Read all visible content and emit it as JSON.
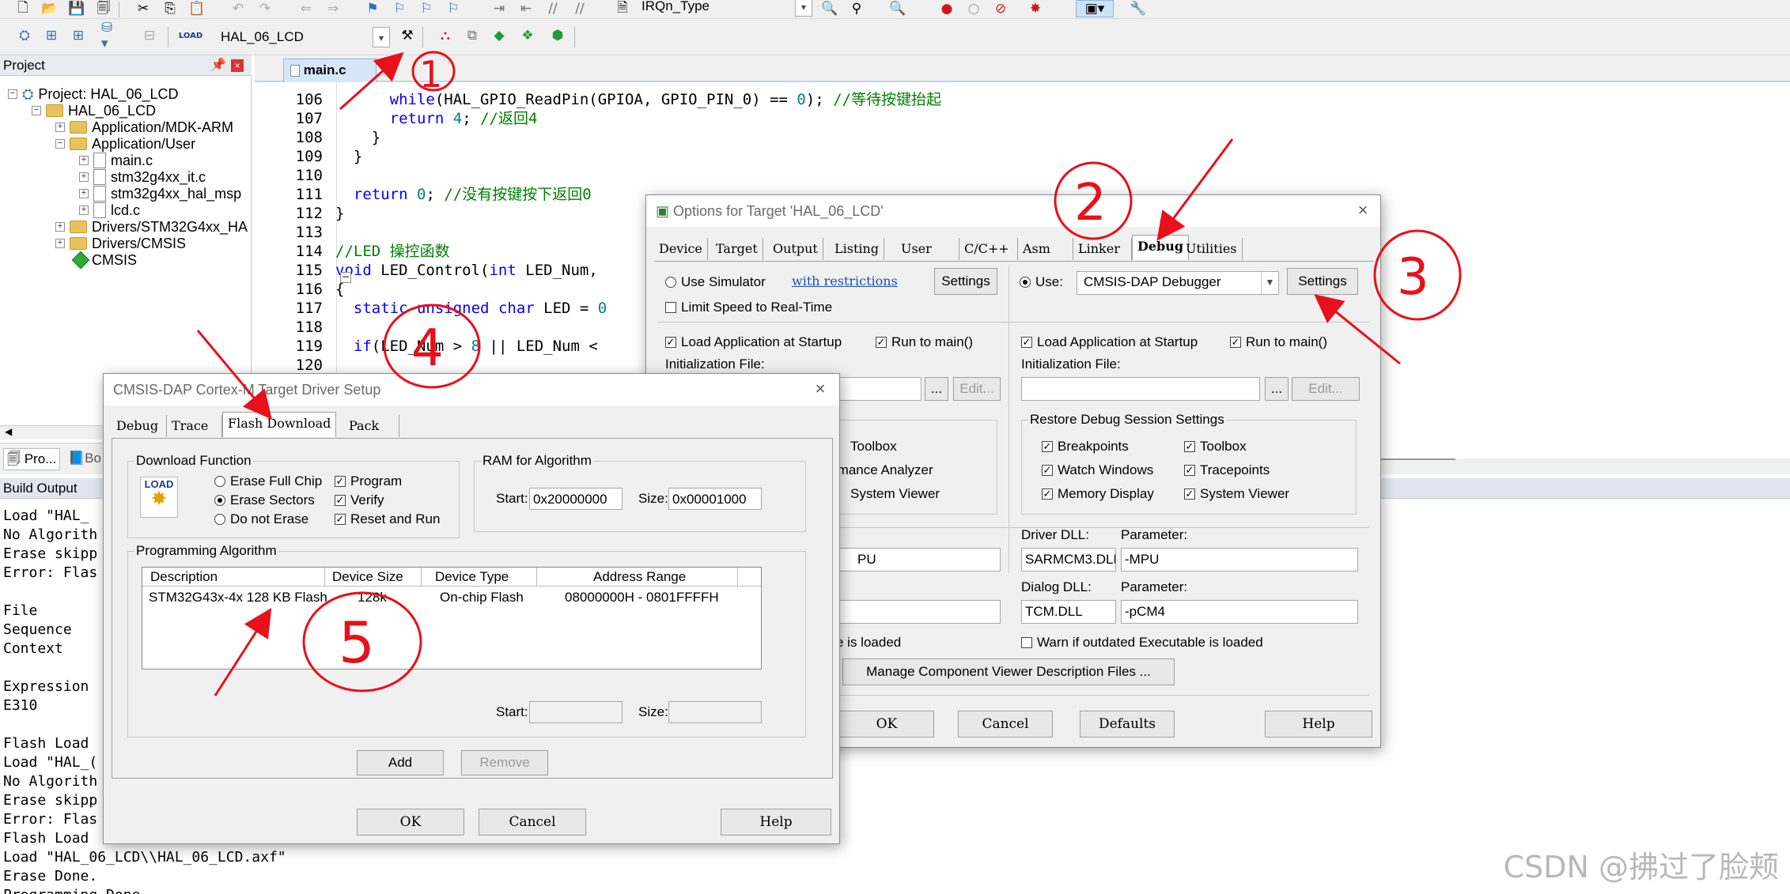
{
  "toolbar1": {
    "target_combo": "IRQn_Type"
  },
  "toolbar2": {
    "project_combo": "HAL_06_LCD"
  },
  "project_pane": {
    "title": "Project",
    "tree": [
      {
        "label": "Project: HAL_06_LCD",
        "kind": "root"
      },
      {
        "label": "HAL_06_LCD",
        "kind": "target"
      },
      {
        "label": "Application/MDK-ARM",
        "kind": "folder"
      },
      {
        "label": "Application/User",
        "kind": "folder"
      },
      {
        "label": "main.c",
        "kind": "file"
      },
      {
        "label": "stm32g4xx_it.c",
        "kind": "file"
      },
      {
        "label": "stm32g4xx_hal_msp",
        "kind": "file"
      },
      {
        "label": "lcd.c",
        "kind": "file"
      },
      {
        "label": "Drivers/STM32G4xx_HA",
        "kind": "folder"
      },
      {
        "label": "Drivers/CMSIS",
        "kind": "folder"
      },
      {
        "label": "CMSIS",
        "kind": "component"
      }
    ],
    "bottom_tabs": [
      "Pro...",
      "Bo"
    ]
  },
  "editor": {
    "tab": "main.c",
    "lines": [
      {
        "n": "106",
        "code": "      while(HAL_GPIO_ReadPin(GPIOA, GPIO_PIN_0) == 0); //等待按键抬起"
      },
      {
        "n": "107",
        "code": "      return 4; //返回4"
      },
      {
        "n": "108",
        "code": "    }"
      },
      {
        "n": "109",
        "code": "  }"
      },
      {
        "n": "110",
        "code": ""
      },
      {
        "n": "111",
        "code": "  return 0; //没有按键按下返回0"
      },
      {
        "n": "112",
        "code": "}"
      },
      {
        "n": "113",
        "code": ""
      },
      {
        "n": "114",
        "code": "//LED 操控函数"
      },
      {
        "n": "115",
        "code": "void LED_Control(int LED_Num,"
      },
      {
        "n": "116",
        "code": "{"
      },
      {
        "n": "117",
        "code": "  static unsigned char LED = 0"
      },
      {
        "n": "118",
        "code": ""
      },
      {
        "n": "119",
        "code": "  if(LED_Num > 8 || LED_Num <"
      },
      {
        "n": "120",
        "code": ""
      }
    ]
  },
  "build_output": {
    "title": "Build Output",
    "lines": [
      "Load \"HAL_",
      "No Algorith",
      "Erase skipp",
      "Error: Flas",
      "",
      "File",
      "Sequence",
      "Context",
      "",
      "Expression",
      "E310",
      "",
      "Flash Load",
      "Load \"HAL_(",
      "No Algorith",
      "Erase skipp",
      "Error: Flas",
      "Flash Load",
      "Load \"HAL_06_LCD\\\\HAL_06_LCD.axf\"",
      "Erase Done.",
      "Programming Done."
    ]
  },
  "options_dialog": {
    "title": "Options for Target 'HAL_06_LCD'",
    "tabs": [
      "Device",
      "Target",
      "Output",
      "Listing",
      "User",
      "C/C++",
      "Asm",
      "Linker",
      "Debug",
      "Utilities"
    ],
    "active_tab": "Debug",
    "use_simulator": "Use Simulator",
    "with_restrictions": "with restrictions",
    "settings": "Settings",
    "use": "Use:",
    "debugger": "CMSIS-DAP Debugger",
    "limit_speed": "Limit Speed to Real-Time",
    "load_app": "Load Application at Startup",
    "run_to_main": "Run to main()",
    "init_file": "Initialization File:",
    "edit": "Edit...",
    "browse": "...",
    "restore_group": "Restore Debug Session Settings",
    "breakpoints": "Breakpoints",
    "toolbox": "Toolbox",
    "watch_windows": "Watch Windows",
    "tracepoints": "Tracepoints",
    "memory_display": "Memory Display",
    "system_viewer": "System Viewer",
    "left_restore_partial": "ngs",
    "left_toolbox": "Toolbox",
    "left_perf": "rmance Analyzer",
    "left_sysviewer": "System Viewer",
    "driver_dll": "Driver DLL:",
    "parameter": "Parameter:",
    "dialog_dll": "Dialog DLL:",
    "driver_dll_value": "SARMCM3.DLL",
    "driver_param": "-MPU",
    "dialog_dll_value": "TCM.DLL",
    "dialog_param": "-pCM4",
    "left_driver_partial": "PU",
    "warn_outdated": "Warn if outdated Executable is loaded",
    "left_warn_partial": "e is loaded",
    "manage_viewer": "Manage Component Viewer Description Files ...",
    "ok": "OK",
    "cancel": "Cancel",
    "defaults": "Defaults",
    "help": "Help"
  },
  "cmsis_dialog": {
    "title": "CMSIS-DAP Cortex-M Target Driver Setup",
    "tabs": [
      "Debug",
      "Trace",
      "Flash Download",
      "Pack"
    ],
    "active_tab": "Flash Download",
    "download_function": "Download Function",
    "load_icon": "LOAD",
    "erase_full": "Erase Full Chip",
    "erase_sectors": "Erase Sectors",
    "do_not_erase": "Do not Erase",
    "program": "Program",
    "verify": "Verify",
    "reset_run": "Reset and Run",
    "ram_algorithm": "RAM for Algorithm",
    "start": "Start:",
    "size": "Size:",
    "ram_start": "0x20000000",
    "ram_size": "0x00001000",
    "prog_algorithm": "Programming Algorithm",
    "columns": [
      "Description",
      "Device Size",
      "Device Type",
      "Address Range"
    ],
    "rows": [
      [
        "STM32G43x-4x 128 KB Flash",
        "128k",
        "On-chip Flash",
        "08000000H - 0801FFFFH"
      ]
    ],
    "add": "Add",
    "remove": "Remove",
    "ok": "OK",
    "cancel": "Cancel",
    "help": "Help"
  },
  "annotations": [
    "1",
    "2",
    "3",
    "4",
    "5"
  ],
  "watermark": "CSDN @拂过了脸颊",
  "colors": {
    "annotation": "#e8101a",
    "keyword": "#0000ff",
    "comment": "#008000",
    "number": "#008080"
  }
}
